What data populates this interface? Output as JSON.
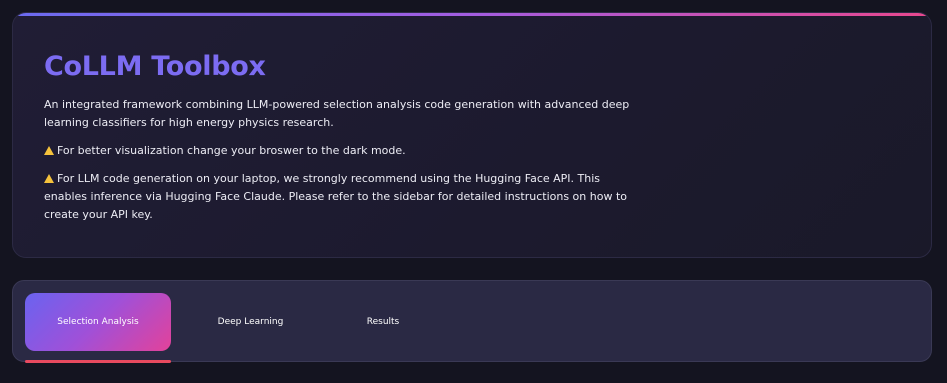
{
  "header": {
    "title": "CoLLM Toolbox",
    "description": "An integrated framework combining LLM-powered selection analysis code generation with advanced deep learning classifiers for high energy physics research.",
    "notice_browser": "For better visualization change your broswer to the dark mode.",
    "notice_api": "For LLM code generation on your laptop, we strongly recommend using the Hugging Face API. This enables inference via Hugging Face Claude. Please refer to the sidebar for detailed instructions on how to create your API key."
  },
  "tabs": {
    "items": [
      {
        "label": "Selection Analysis",
        "active": true
      },
      {
        "label": "Deep Learning",
        "active": false
      },
      {
        "label": "Results",
        "active": false
      }
    ]
  },
  "colors": {
    "background": "#141420",
    "title": "#7c6cf2",
    "active_tab_start": "#6a63f0",
    "active_tab_end": "#e3429a",
    "warning": "#f5c23c"
  }
}
